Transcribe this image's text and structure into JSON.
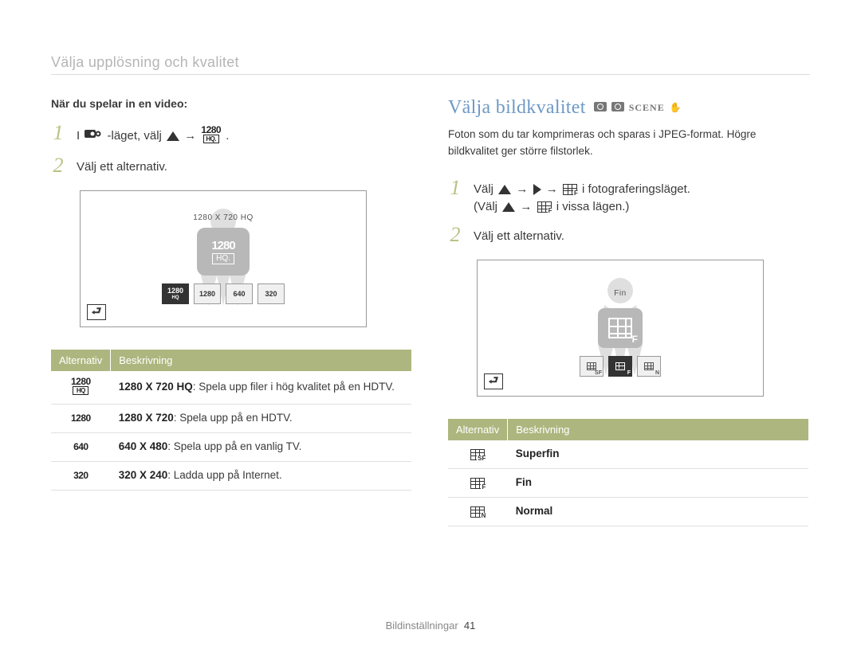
{
  "page_subtitle": "Välja upplösning och kvalitet",
  "left": {
    "when_heading": "När du spelar in en video:",
    "step1_pre": "I ",
    "step1_mid": "-läget, välj ",
    "step1_end": ".",
    "step2": "Välj ett alternativ.",
    "screen_caption": "1280 X 720 HQ",
    "big_badge_top": "1280",
    "big_badge_sub": "HQ.",
    "thumbs": [
      {
        "top": "1280",
        "sub": "HQ"
      },
      {
        "top": "1280",
        "sub": ""
      },
      {
        "top": "640",
        "sub": ""
      },
      {
        "top": "320",
        "sub": ""
      }
    ],
    "table_headers": [
      "Alternativ",
      "Beskrivning"
    ],
    "rows": [
      {
        "icon_top": "1280",
        "icon_sub": "HQ",
        "title": "1280 X 720 HQ",
        "desc": ": Spela upp filer i hög kvalitet på en HDTV."
      },
      {
        "icon_top": "1280",
        "icon_sub": "",
        "title": "1280 X 720",
        "desc": ": Spela upp på en HDTV."
      },
      {
        "icon_top": "640",
        "icon_sub": "",
        "title": "640 X 480",
        "desc": ": Spela upp på en vanlig TV."
      },
      {
        "icon_top": "320",
        "icon_sub": "",
        "title": "320 X 240",
        "desc": ": Ladda upp på Internet."
      }
    ]
  },
  "right": {
    "title": "Välja bildkvalitet",
    "desc": "Foton som du tar komprimeras och sparas i JPEG-format. Högre bildkvalitet ger större filstorlek.",
    "step1_a": "Välj ",
    "step1_b": " i fotograferingsläget.",
    "step1_c": "(Välj ",
    "step1_d": " i vissa lägen.)",
    "step2": "Välj ett alternativ.",
    "screen_caption": "Fin",
    "thumb_subs": [
      "SF",
      "F",
      "N"
    ],
    "selected_sub": "F",
    "table_headers": [
      "Alternativ",
      "Beskrivning"
    ],
    "rows": [
      {
        "sub": "SF",
        "label": "Superfin"
      },
      {
        "sub": "F",
        "label": "Fin"
      },
      {
        "sub": "N",
        "label": "Normal"
      }
    ],
    "modes": [
      "camera",
      "camera",
      "SCENE",
      "hand"
    ]
  },
  "footer": {
    "section": "Bildinställningar",
    "page": "41"
  }
}
